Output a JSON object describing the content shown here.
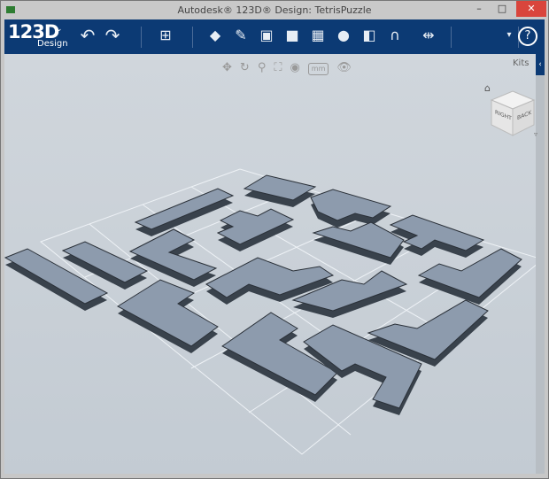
{
  "window": {
    "title": "Autodesk® 123D® Design: TetrisPuzzle",
    "minimize": "–",
    "maximize": "□",
    "close": "✕"
  },
  "toolbar": {
    "logo": "123D",
    "logo_sub": "Design",
    "logo_menu": "⌄",
    "undo": "↶",
    "redo": "↷",
    "tools": [
      {
        "icon": "transform-icon",
        "glyph": "⊞"
      },
      {
        "icon": "primitives-icon",
        "glyph": "◆"
      },
      {
        "icon": "sketch-icon",
        "glyph": "✎"
      },
      {
        "icon": "construct-icon",
        "glyph": "▣"
      },
      {
        "icon": "modify-icon",
        "glyph": "■"
      },
      {
        "icon": "pattern-icon",
        "glyph": "▦"
      },
      {
        "icon": "grouping-icon",
        "glyph": "●"
      },
      {
        "icon": "combine-icon",
        "glyph": "◧"
      },
      {
        "icon": "snap-icon",
        "glyph": "∩"
      },
      {
        "icon": "measure-icon",
        "glyph": "⇹"
      }
    ],
    "more": "▾",
    "help": "?"
  },
  "nav": {
    "pan": "✥",
    "orbit": "↻",
    "zoom": "⚲",
    "fit": "⛶",
    "material": "◉",
    "units": "mm",
    "visibility": "👁"
  },
  "kits": {
    "label": "Kits",
    "tab": "‹"
  },
  "viewcube": {
    "right": "RIGHT",
    "back": "BACK",
    "home": "⌂"
  }
}
